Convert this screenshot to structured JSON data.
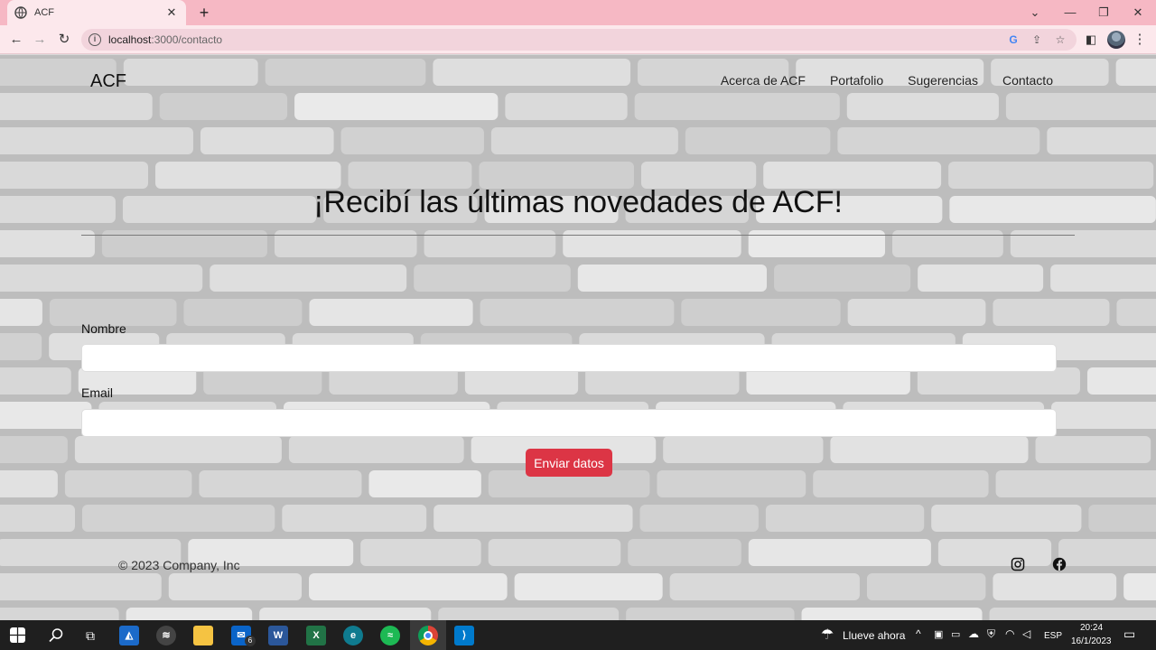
{
  "browser": {
    "tab_title": "ACF",
    "url_host": "localhost",
    "url_path": ":3000/contacto"
  },
  "site": {
    "brand": "ACF",
    "nav": [
      "Acerca de ACF",
      "Portafolio",
      "Sugerencias",
      "Contacto"
    ],
    "heading": "¡Recibí las últimas novedades de ACF!",
    "form": {
      "name_label": "Nombre",
      "name_value": "",
      "email_label": "Email",
      "email_value": "",
      "submit_label": "Enviar datos"
    },
    "footer": {
      "copyright": "© 2023 Company, Inc",
      "social_icons": [
        "instagram-icon",
        "facebook-icon"
      ]
    }
  },
  "taskbar": {
    "weather": "Llueve ahora",
    "language": "ESP",
    "time": "20:24",
    "date": "16/1/2023",
    "mail_badge": "6"
  },
  "colors": {
    "tab_strip": "#f6b8c4",
    "toolbar": "#fce8ec",
    "submit_button": "#dc3545"
  }
}
